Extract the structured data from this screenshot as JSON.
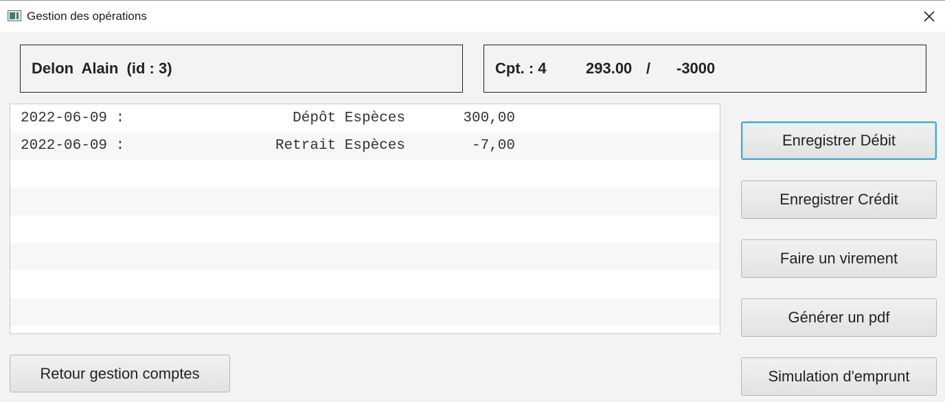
{
  "window": {
    "title": "Gestion des opérations",
    "close_icon": "close-icon"
  },
  "client_info": {
    "text": "Delon  Alain  (id : 3)"
  },
  "account_info": {
    "account_label": "Cpt. : 4",
    "balance": "293.00",
    "separator": "/",
    "overdraft": "-3000"
  },
  "operations": [
    {
      "date": "2022-06-09 :",
      "label": "Dépôt Espèces",
      "amount": "300,00"
    },
    {
      "date": "2022-06-09 :",
      "label": "Retrait Espèces",
      "amount": "-7,00"
    },
    {
      "date": "",
      "label": "",
      "amount": ""
    },
    {
      "date": "",
      "label": "",
      "amount": ""
    },
    {
      "date": "",
      "label": "",
      "amount": ""
    },
    {
      "date": "",
      "label": "",
      "amount": ""
    },
    {
      "date": "",
      "label": "",
      "amount": ""
    },
    {
      "date": "",
      "label": "",
      "amount": ""
    }
  ],
  "buttons": {
    "debit": "Enregistrer Débit",
    "credit": "Enregistrer Crédit",
    "transfer": "Faire un virement",
    "pdf": "Générer un pdf",
    "loan": "Simulation d'emprunt",
    "back": "Retour gestion comptes"
  },
  "colors": {
    "focus_border": "#3fa6d8",
    "window_bg": "#f3f3f3"
  }
}
